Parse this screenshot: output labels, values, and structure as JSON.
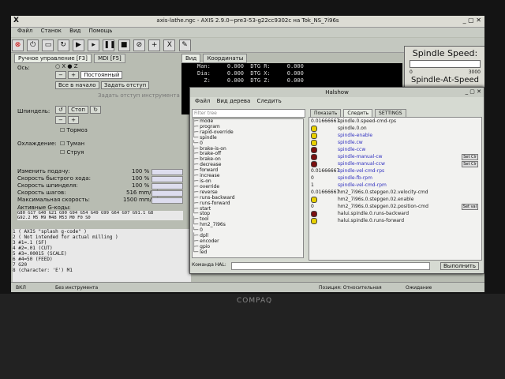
{
  "window": {
    "title": "axis-lathe.ngc - AXIS 2.9.0~pre3-53-g22cc9302c на Tok_NS_7i96s"
  },
  "menu": [
    "Файл",
    "Станок",
    "Вид",
    "Помощь"
  ],
  "tabs": {
    "manual": "Ручное управление [F3]",
    "mdi": "MDI [F5]",
    "preview": "Вид",
    "dro": "Координаты"
  },
  "manual": {
    "axis_label": "Ось:",
    "axis_x": "X",
    "axis_z": "Z",
    "jog_mode": "Постоянный",
    "home_button": "Все в начало",
    "offset_button": "Задать отступ",
    "tool_offset_button": "Задать отступ инструмента",
    "spindle_label": "Шпиндель:",
    "stop_button": "Стоп",
    "brake": "Тормоз",
    "coolant_label": "Охлаждение:",
    "mist": "Туман",
    "flood": "Струя"
  },
  "overrides": [
    {
      "label": "Изменить подачу:",
      "value": "100 %"
    },
    {
      "label": "Скорость быстрого хода:",
      "value": "100 %"
    },
    {
      "label": "Скорость шпинделя:",
      "value": "100 %"
    },
    {
      "label": "Скорость шагов:",
      "value": "516 mm/min"
    },
    {
      "label": "Максимальная скорость:",
      "value": "1500 mm/min"
    }
  ],
  "active_codes": {
    "label": "Активные G-коды:",
    "line1": "G80 G17 G40 G21 G90 G94 G54 G49 G99 G64 G97 G91.1 G8",
    "line2": "G92.2 M5 M9 M48 M53 M0 F0 S0"
  },
  "gcode_lines": [
    "1  ( AXIS \"splash g-code\" )",
    "2  ( Not intended for actual milling )",
    "3  #1=.1 (SF)",
    "4  #2=.01 (CUT)",
    "5  #3=.00015 (SCALE)",
    "6  #4=50 (FEED)",
    "7  G20",
    "8  (character: 'E') M1"
  ],
  "dro": [
    "Man:     0.000  DTG R:     0.000",
    "Dia:     0.000  DTG X:     0.000",
    "  Z:     0.000  DTG Z:     0.000"
  ],
  "spindle_panel": {
    "title": "Spindle Speed:",
    "value": "0",
    "max": "3000",
    "at_speed": "Spindle-At-Speed"
  },
  "halshow": {
    "title": "Halshow",
    "menu": [
      "Файл",
      "Вид дерева",
      "Следить"
    ],
    "filter_placeholder": "Filter tree",
    "tabs": [
      "Показать",
      "Следить",
      "SETTINGS"
    ],
    "tree": [
      "├─ mode",
      "├─ program",
      "├─ rapid-override",
      "└─ spindle",
      "   └─ 0",
      "      ├─ brake-is-on",
      "      ├─ brake-off",
      "      ├─ brake-on",
      "      ├─ decrease",
      "      ├─ forward",
      "      ├─ increase",
      "      ├─ is-on",
      "      ├─ override",
      "      ├─ reverse",
      "      ├─ runs-backward",
      "      ├─ runs-forward",
      "      ├─ start",
      "      └─ stop",
      "├─ tool",
      "└─ hm2_7i96s",
      "   └─ 0",
      "      ├─ dpll",
      "      ├─ encoder",
      "      ├─ gpio",
      "      └─ led"
    ],
    "watch": [
      {
        "value": "0.01666667",
        "name": "spindle.0.speed-cmd-rps",
        "kind": "value",
        "blue": false,
        "buttons": ""
      },
      {
        "value": "",
        "name": "spindle.0.on",
        "kind": "yellow",
        "blue": false,
        "buttons": ""
      },
      {
        "value": "",
        "name": "spindle-enable",
        "kind": "yellow",
        "blue": true,
        "buttons": ""
      },
      {
        "value": "",
        "name": "spindle.cw",
        "kind": "yellow",
        "blue": true,
        "buttons": ""
      },
      {
        "value": "",
        "name": "spindle-ccw",
        "kind": "red",
        "blue": true,
        "buttons": ""
      },
      {
        "value": "",
        "name": "spindle-manual-cw",
        "kind": "red",
        "blue": true,
        "buttons": "Set Clr"
      },
      {
        "value": "",
        "name": "spindle-manual-ccw",
        "kind": "red",
        "blue": true,
        "buttons": "Set Clr"
      },
      {
        "value": "0.01666667",
        "name": "spindle-vel-cmd-rps",
        "kind": "value",
        "blue": true,
        "buttons": ""
      },
      {
        "value": "0",
        "name": "spindle-fb-rpm",
        "kind": "value",
        "blue": true,
        "buttons": ""
      },
      {
        "value": "1",
        "name": "spindle-vel-cmd-rpm",
        "kind": "value",
        "blue": true,
        "buttons": ""
      },
      {
        "value": "0.01666667",
        "name": "hm2_7i96s.0.stepgen.02.velocity-cmd",
        "kind": "value",
        "blue": false,
        "buttons": ""
      },
      {
        "value": "",
        "name": "hm2_7i96s.0.stepgen.02.enable",
        "kind": "yellow",
        "blue": false,
        "buttons": ""
      },
      {
        "value": "0",
        "name": "hm2_7i96s.0.stepgen.02.position-cmd",
        "kind": "value",
        "blue": false,
        "buttons": "Set val"
      },
      {
        "value": "",
        "name": "halui.spindle.0.runs-backward",
        "kind": "red",
        "blue": false,
        "buttons": ""
      },
      {
        "value": "",
        "name": "halui.spindle.0.runs-forward",
        "kind": "yellow",
        "blue": false,
        "buttons": ""
      }
    ],
    "command_label": "Команда HAL:",
    "execute_button": "Выполнить"
  },
  "status": {
    "state": "ВКЛ",
    "tool": "Без инструмента",
    "position": "Позиция: Относительная",
    "ready": "Ожидание"
  },
  "brand": "COMPAQ",
  "colors": {
    "led_yellow": "#e8d000",
    "led_red": "#7a1010",
    "dro_bg": "#000000"
  }
}
